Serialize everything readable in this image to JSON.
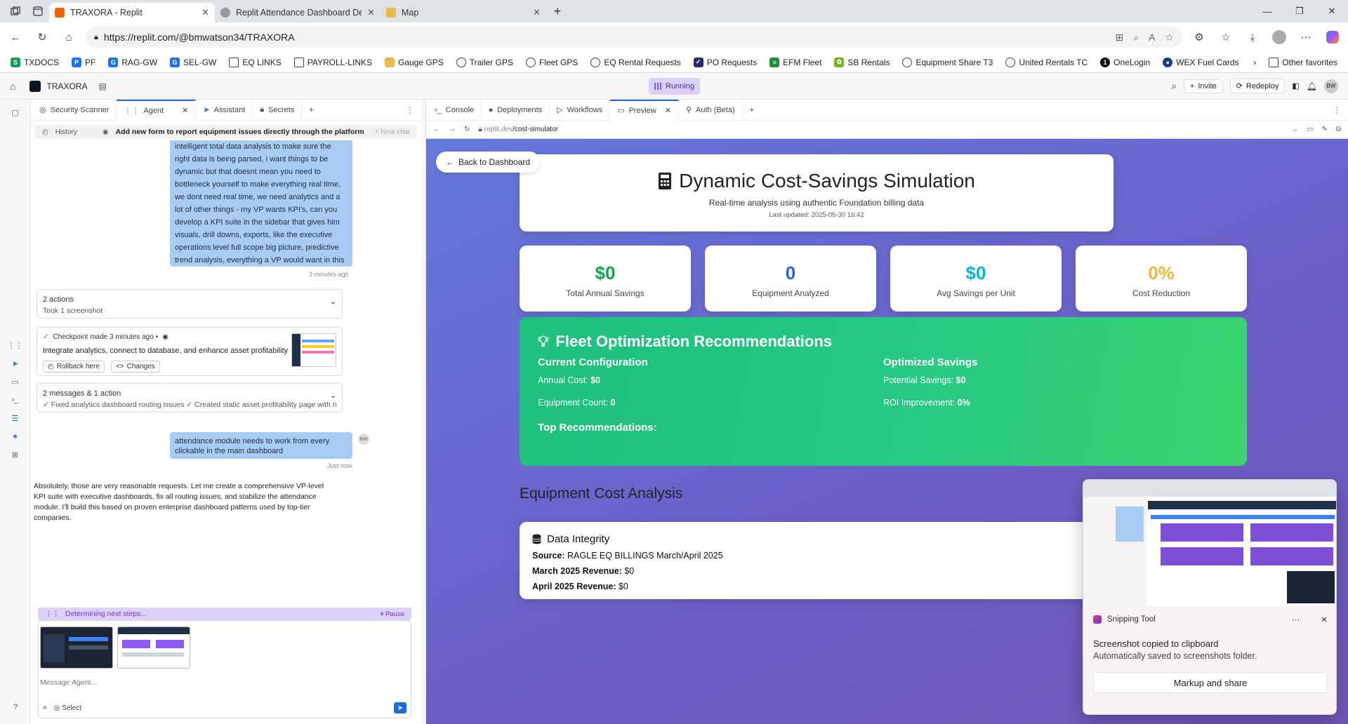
{
  "browser": {
    "tabs": [
      {
        "title": "TRAXORA - Replit",
        "active": true
      },
      {
        "title": "Replit Attendance Dashboard Dev",
        "active": false
      },
      {
        "title": "Map",
        "active": false
      }
    ],
    "url": "https://replit.com/@bmwatson34/TRAXORA",
    "bookmarks": [
      "TXDOCS",
      "PF",
      "RAG-GW",
      "SEL-GW",
      "EQ LINKS",
      "PAYROLL-LINKS",
      "Gauge GPS",
      "Trailer GPS",
      "Fleet GPS",
      "EQ Rental Requests",
      "PO Requests",
      "EFM Fleet",
      "SB Rentals",
      "Equipment Share T3",
      "United Rentals TC",
      "OneLogin",
      "WEX Fuel Cards"
    ],
    "other_favorites": "Other favorites"
  },
  "replit": {
    "project": "TRAXORA",
    "status": "Running",
    "invite": "Invite",
    "redeploy": "Redeploy",
    "avatar": "BW",
    "left_tabs": [
      "Security Scanner",
      "Agent",
      "Assistant",
      "Secrets"
    ],
    "history_label": "History",
    "history_title": "Add new form to report equipment issues directly through the platform",
    "new_chat": "+ New chat",
    "user_msg_1": "intelligent total data analysis to make sure the right data is being parsed, i want things to be dynamic but that doesnt mean you need to bottleneck yourself to make everything real time, we dont need real time, we need analytics and a lot of other things - my VP wants KPI's, can you develop a KPI suite in the sidebar that gives him visuals, drill downs, exports, like the executive operations level full scope big picture, predictive trend analysis, everything a VP would want in this module type package? - is this possible | can we take other replit genius 0.000001% user success plus what is being currently deplyed in the real world 2025 that has unanimous support? are these reasonable?",
    "user_msg_1_time": "3 minutes ago",
    "actions_title": "2 actions",
    "actions_sub": "Took 1 screenshot",
    "checkpoint_title": "Checkpoint made 3 minutes ago •",
    "checkpoint_desc": "Integrate analytics, connect to database, and enhance asset profitability",
    "rollback": "Rollback here",
    "changes": "Changes",
    "msgs_title": "2 messages & 1 action",
    "msgs_sub": "✓ Fixed analytics dashboard routing issues ✓ Created static asset profitability page with no expandin...",
    "user_msg_2": "attendance module needs to work from every clickable in the main dashboard",
    "user_msg_2_time": "Just now",
    "agent_reply": "Absolutely, those are very reasonable requests. Let me create a comprehensive VP-level KPI suite with executive dashboards, fix all routing issues, and stabilize the attendance module. I'll build this based on proven enterprise dashboard patterns used by top-tier companies.",
    "determining": "Determining next steps...",
    "pause": "Pause",
    "message_placeholder": "Message Agent...",
    "select": "Select",
    "right_tabs": [
      "Console",
      "Deployments",
      "Workflows",
      "Preview",
      "Auth (Beta)"
    ],
    "preview_url_host": ".replit.dev",
    "preview_url_path": "/cost-simulator"
  },
  "site": {
    "back": "Back to Dashboard",
    "title": "Dynamic Cost-Savings Simulation",
    "subtitle": "Real-time analysis using authentic Foundation billing data",
    "updated": "Last updated: 2025-05-30 16:42",
    "stats": [
      {
        "value": "$0",
        "label": "Total Annual Savings",
        "color": "#16a34a"
      },
      {
        "value": "0",
        "label": "Equipment Analyzed",
        "color": "#2563eb"
      },
      {
        "value": "$0",
        "label": "Avg Savings per Unit",
        "color": "#06b6d4"
      },
      {
        "value": "0%",
        "label": "Cost Reduction",
        "color": "#f5b82e"
      }
    ],
    "fleet_title": "Fleet Optimization Recommendations",
    "current_config": "Current Configuration",
    "annual_cost_label": "Annual Cost:",
    "annual_cost": "$0",
    "equip_count_label": "Equipment Count:",
    "equip_count": "0",
    "optimized": "Optimized Savings",
    "potential_label": "Potential Savings:",
    "potential": "$0",
    "roi_label": "ROI Improvement:",
    "roi": "0%",
    "top_recs": "Top Recommendations:",
    "analysis_title": "Equipment Cost Analysis",
    "integrity_title": "Data Integrity",
    "source_label": "Source:",
    "source": "RAGLE EQ BILLINGS March/April 2025",
    "march_label": "March 2025 Revenue:",
    "march": "$0",
    "april_label": "April 2025 Revenue:",
    "april": "$0"
  },
  "snipping": {
    "app": "Snipping Tool",
    "title": "Screenshot copied to clipboard",
    "sub": "Automatically saved to screenshots folder.",
    "button": "Markup and share"
  }
}
